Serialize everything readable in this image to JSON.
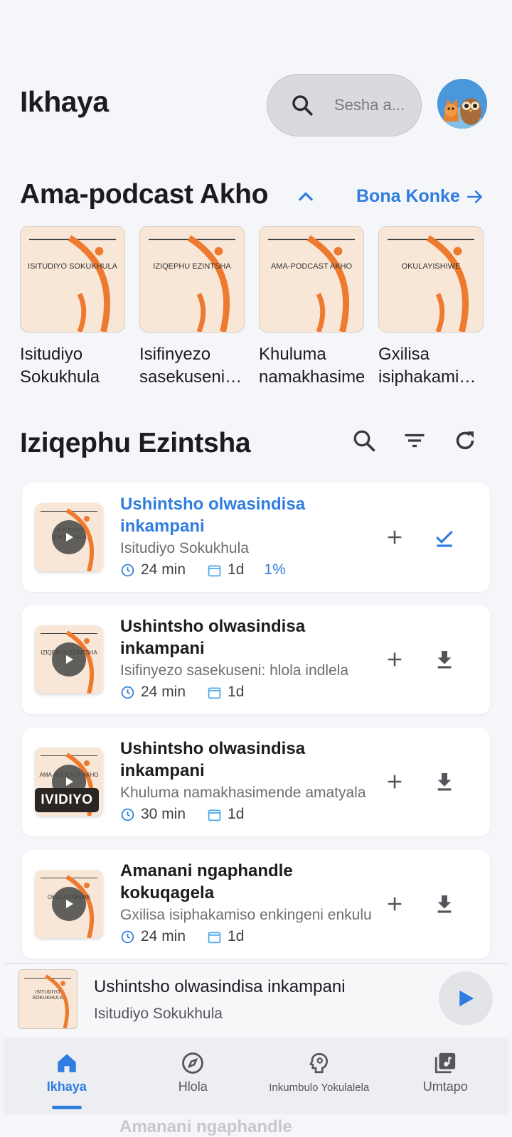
{
  "header": {
    "title": "Ikhaya",
    "search_placeholder": "Sesha a...",
    "avatar_icon": "fox-owl-avatar"
  },
  "podcasts": {
    "title": "Ama-podcast Akho",
    "see_all_label": "Bona Konke",
    "items": [
      {
        "cover_text": "ISITUDIYO SOKUKHULA",
        "name": "Isitudiyo Sokukhula"
      },
      {
        "cover_text": "IZIQEPHU EZINTSHA",
        "name": "Isifinyezo sasekuseni: hlola indlela"
      },
      {
        "cover_text": "AMA-PODCAST AKHO",
        "name": "Khuluma namakhasimende"
      },
      {
        "cover_text": "OKULAYISHIWE",
        "name": "Gxilisa isiphakamiso enkingeni"
      }
    ]
  },
  "episodes": {
    "title": "Iziqephu Ezintsha",
    "items": [
      {
        "cover_text": "ISITUDIYO SOKUKHULA",
        "title": "Ushintsho olwasindisa inkampani",
        "show": "Isitudiyo Sokukhula",
        "duration": "24 min",
        "date": "1d",
        "progress": "1%",
        "active": true,
        "action_icon": "check-icon"
      },
      {
        "cover_text": "IZIQEPHU EZINTSHA",
        "title": "Ushintsho olwasindisa inkampani",
        "show": "Isifinyezo sasekuseni: hlola indlela",
        "duration": "24 min",
        "date": "1d",
        "progress": "",
        "active": false,
        "action_icon": "download-icon"
      },
      {
        "cover_text": "AMA-PODCAST AKHO",
        "title": "Ushintsho olwasindisa inkampani",
        "show": "Khuluma namakhasimende amatyala",
        "duration": "30 min",
        "date": "1d",
        "progress": "",
        "active": false,
        "badge": "IVIDIYO",
        "action_icon": "download-icon"
      },
      {
        "cover_text": "OKULAYISHIWE",
        "title": "Amanani ngaphandle kokuqagela",
        "show": "Gxilisa isiphakamiso enkingeni enkulu",
        "duration": "24 min",
        "date": "1d",
        "progress": "",
        "active": false,
        "action_icon": "download-icon"
      }
    ],
    "ghost_title": "Amanani ngaphandle"
  },
  "player": {
    "cover_text": "ISITUDIYO SOKUKHULA",
    "title": "Ushintsho olwasindisa inkampani",
    "show": "Isitudiyo Sokukhula"
  },
  "nav": {
    "items": [
      {
        "label": "Ikhaya",
        "icon": "home-icon",
        "active": true
      },
      {
        "label": "Hlola",
        "icon": "compass-icon",
        "active": false
      },
      {
        "label": "Inkumbulo Yokulalela",
        "icon": "brain-icon",
        "active": false
      },
      {
        "label": "Umtapo",
        "icon": "library-music-icon",
        "active": false
      }
    ]
  },
  "colors": {
    "accent": "#2f7de0",
    "cover_bg": "#f8e6d6",
    "cover_arc": "#ee7a2f"
  }
}
